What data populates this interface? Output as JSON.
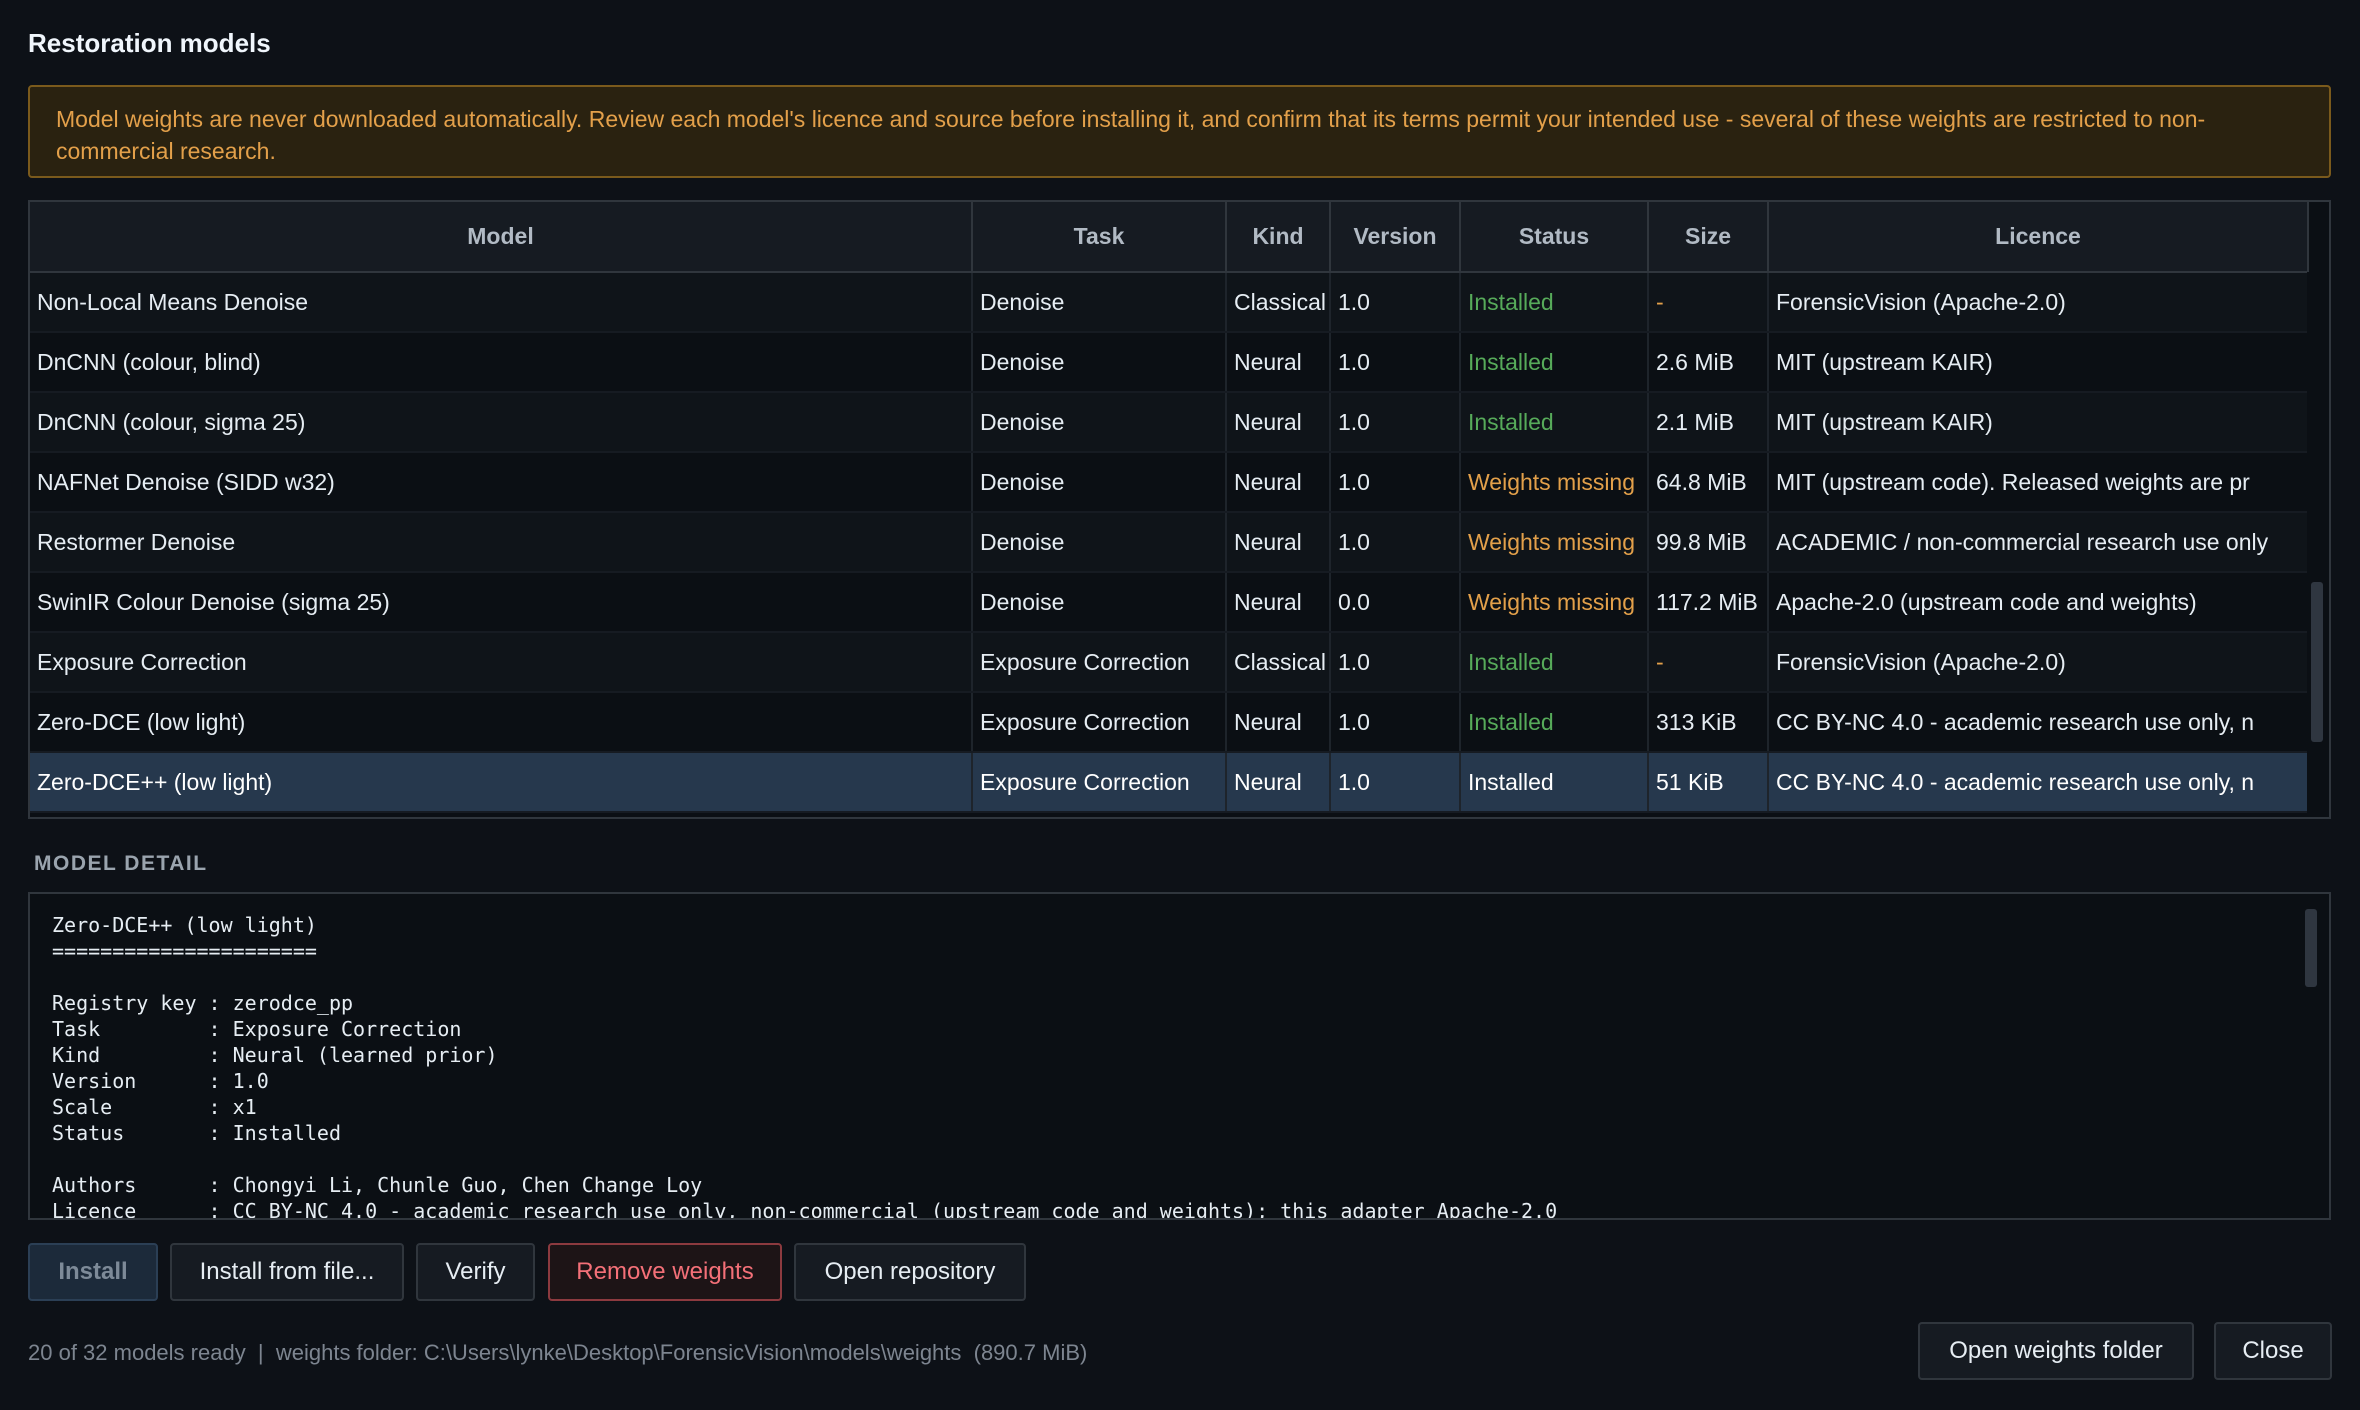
{
  "title": "Restoration models",
  "warning": "Model weights are never downloaded automatically. Review each model's licence and source before installing it, and confirm that its terms permit your intended use - several of these weights are restricted to non-commercial research.",
  "table": {
    "columns": [
      "Model",
      "Task",
      "Kind",
      "Version",
      "Status",
      "Size",
      "Licence"
    ],
    "rows": [
      {
        "model": "Non-Local Means Denoise",
        "task": "Denoise",
        "kind": "Classical",
        "version": "1.0",
        "status": "Installed",
        "size": "-",
        "licence": "ForensicVision (Apache-2.0)"
      },
      {
        "model": "DnCNN (colour, blind)",
        "task": "Denoise",
        "kind": "Neural",
        "version": "1.0",
        "status": "Installed",
        "size": "2.6 MiB",
        "licence": "MIT (upstream KAIR)"
      },
      {
        "model": "DnCNN (colour, sigma 25)",
        "task": "Denoise",
        "kind": "Neural",
        "version": "1.0",
        "status": "Installed",
        "size": "2.1 MiB",
        "licence": "MIT (upstream KAIR)"
      },
      {
        "model": "NAFNet Denoise (SIDD w32)",
        "task": "Denoise",
        "kind": "Neural",
        "version": "1.0",
        "status": "Weights missing",
        "size": "64.8 MiB",
        "licence": "MIT (upstream code). Released weights are pr"
      },
      {
        "model": "Restormer Denoise",
        "task": "Denoise",
        "kind": "Neural",
        "version": "1.0",
        "status": "Weights missing",
        "size": "99.8 MiB",
        "licence": "ACADEMIC / non-commercial research use only"
      },
      {
        "model": "SwinIR Colour Denoise (sigma 25)",
        "task": "Denoise",
        "kind": "Neural",
        "version": "0.0",
        "status": "Weights missing",
        "size": "117.2 MiB",
        "licence": "Apache-2.0 (upstream code and weights)"
      },
      {
        "model": "Exposure Correction",
        "task": "Exposure Correction",
        "kind": "Classical",
        "version": "1.0",
        "status": "Installed",
        "size": "-",
        "licence": "ForensicVision (Apache-2.0)"
      },
      {
        "model": "Zero-DCE (low light)",
        "task": "Exposure Correction",
        "kind": "Neural",
        "version": "1.0",
        "status": "Installed",
        "size": "313 KiB",
        "licence": "CC BY-NC 4.0 - academic research use only, n"
      },
      {
        "model": "Zero-DCE++ (low light)",
        "task": "Exposure Correction",
        "kind": "Neural",
        "version": "1.0",
        "status": "Installed",
        "size": "51 KiB",
        "licence": "CC BY-NC 4.0 - academic research use only, n"
      }
    ],
    "selected_index": 8
  },
  "detail": {
    "label": "MODEL DETAIL",
    "text": "Zero-DCE++ (low light)\n======================\n\nRegistry key : zerodce_pp\nTask         : Exposure Correction\nKind         : Neural (learned prior)\nVersion      : 1.0\nScale        : x1\nStatus       : Installed\n\nAuthors      : Chongyi Li, Chunle Guo, Chen Change Loy\nLicence      : CC BY-NC 4.0 - academic research use only, non-commercial (upstream code and weights); this adapter Apache-2.0"
  },
  "buttons": {
    "install": "Install",
    "install_from_file": "Install from file...",
    "verify": "Verify",
    "remove_weights": "Remove weights",
    "open_repository": "Open repository",
    "open_weights_folder": "Open weights folder",
    "close": "Close"
  },
  "status_bar": "20 of 32 models ready  |  weights folder: C:\\Users\\lynke\\Desktop\\ForensicVision\\models\\weights  (890.7 MiB)",
  "colors": {
    "background": "#0d1117",
    "installed": "#57ab5a",
    "weights_missing": "#e3a04a",
    "warning_text": "#e3a04a",
    "selected_row": "#26384d",
    "remove_button": "#f47078"
  }
}
